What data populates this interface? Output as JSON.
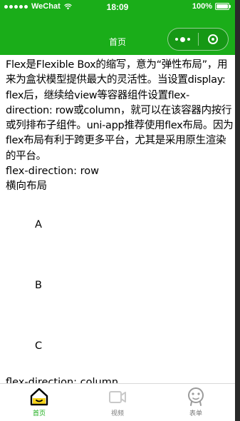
{
  "status_bar": {
    "carrier": "WeChat",
    "time": "18:09",
    "battery": "100%"
  },
  "nav": {
    "title": "首页"
  },
  "content": {
    "intro": "Flex是Flexible Box的缩写，意为“弹性布局”，用来为盒状模型提供最大的灵活性。当设置display: flex后，继续给view等容器组件设置flex-direction: row或column，就可以在该容器内按行或列排布子组件。uni-app推荐使用flex布局。因为flex布局有利于跨更多平台，尤其是采用原生渲染的平台。",
    "row_title": "flex-direction: row",
    "row_subtitle": "横向布局",
    "items": [
      "A",
      "B",
      "C"
    ],
    "column_title": "flex-direction: column"
  },
  "tabs": [
    {
      "label": "首页",
      "icon": "home-icon",
      "active": true
    },
    {
      "label": "视频",
      "icon": "video-icon",
      "active": false
    },
    {
      "label": "表单",
      "icon": "form-icon",
      "active": false
    }
  ],
  "colors": {
    "accent": "#1aad19",
    "tab_inactive": "#7a7a7a"
  }
}
